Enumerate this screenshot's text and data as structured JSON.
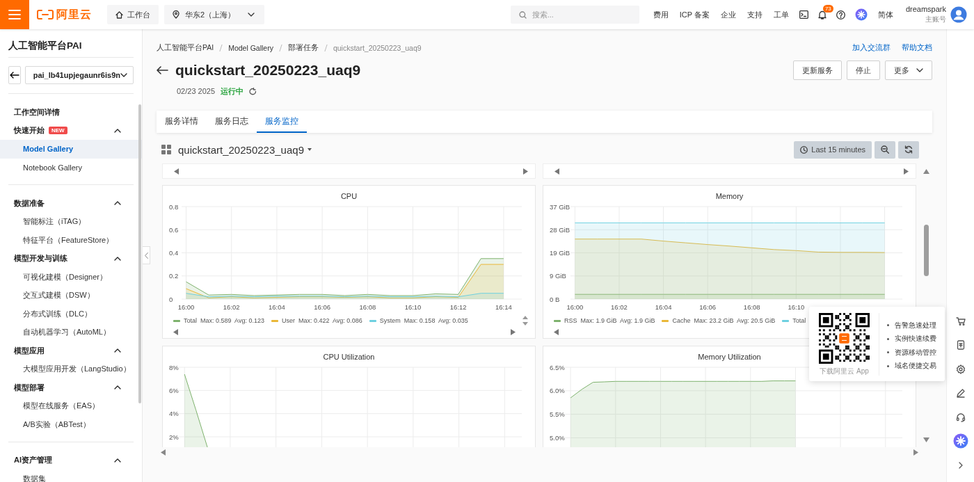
{
  "topbar": {
    "logo": "阿里云",
    "workbench": "工作台",
    "region": "华东2（上海）",
    "search": {
      "placeholder": "搜索..."
    },
    "links": [
      "费用",
      "ICP 备案",
      "企业",
      "支持",
      "工单"
    ],
    "notifications": "73",
    "language": "简体",
    "user": {
      "name": "dreamspark",
      "role": "主账号"
    }
  },
  "sidebar": {
    "title": "人工智能平台PAI",
    "workspace": "pai_lb41upjegaunr6is9n",
    "sections": [
      {
        "items": [
          {
            "kind": "link",
            "label": "工作空间详情"
          },
          {
            "kind": "group",
            "label": "快速开始",
            "badge": "NEW",
            "expanded": true,
            "children": [
              {
                "label": "Model Gallery",
                "selected": true
              },
              {
                "label": "Notebook Gallery",
                "selected": false
              }
            ]
          }
        ]
      },
      {
        "items": [
          {
            "kind": "group",
            "label": "数据准备",
            "expanded": true,
            "children": [
              {
                "label": "智能标注（iTAG）",
                "selected": false
              },
              {
                "label": "特征平台（FeatureStore）",
                "selected": false
              }
            ]
          },
          {
            "kind": "group",
            "label": "模型开发与训练",
            "expanded": true,
            "children": [
              {
                "label": "可视化建模（Designer）",
                "selected": false
              },
              {
                "label": "交互式建模（DSW）",
                "selected": false
              },
              {
                "label": "分布式训练（DLC）",
                "selected": false
              },
              {
                "label": "自动机器学习（AutoML）",
                "selected": false
              }
            ]
          },
          {
            "kind": "group",
            "label": "模型应用",
            "expanded": true,
            "children": [
              {
                "label": "大模型应用开发（LangStudio）",
                "selected": false
              }
            ]
          },
          {
            "kind": "group",
            "label": "模型部署",
            "expanded": true,
            "children": [
              {
                "label": "模型在线服务（EAS）",
                "selected": false
              },
              {
                "label": "A/B实验（ABTest）",
                "selected": false
              }
            ]
          }
        ]
      },
      {
        "items": [
          {
            "kind": "group",
            "label": "AI资产管理",
            "expanded": true,
            "children": [
              {
                "label": "数据集",
                "selected": false
              }
            ]
          }
        ]
      }
    ]
  },
  "header": {
    "breadcrumb": [
      "人工智能平台PAI",
      "Model Gallery",
      "部署任务",
      "quickstart_20250223_uaq9"
    ],
    "links": [
      "加入交流群",
      "帮助文档"
    ],
    "title": "quickstart_20250223_uaq9",
    "buttons": [
      {
        "label": "更新服务",
        "kind": "button"
      },
      {
        "label": "停止",
        "kind": "button"
      },
      {
        "label": "更多",
        "kind": "dropdown"
      }
    ],
    "date": "02/23 2025",
    "status": "运行中",
    "tabs": [
      {
        "label": "服务详情",
        "selected": false
      },
      {
        "label": "服务日志",
        "selected": false
      },
      {
        "label": "服务监控",
        "selected": true
      }
    ]
  },
  "dashboard": {
    "name": "quickstart_20250223_uaq9",
    "time_range": "Last 15 minutes",
    "panels": [
      {
        "legend_stats": [
          "Max: 0.589  Avg: 0.123",
          "Max: 0.422  Avg: 0.086",
          "Max: 0.158  Avg: 0.035"
        ],
        "chart_data": {
          "type": "area",
          "title": "CPU",
          "grid": true,
          "legend": "bottom",
          "categories": [
            "16:00",
            null,
            "16:02",
            null,
            "16:04",
            null,
            "16:06",
            null,
            "16:08",
            null,
            "16:10",
            null,
            "16:12",
            null,
            "16:14"
          ],
          "ylim": [
            0,
            0.8
          ],
          "yticks": [
            0,
            0.2,
            0.4,
            0.6,
            0.8
          ],
          "series": [
            {
              "name": "Total",
              "color": "#7eb26d",
              "values": [
                0.15,
                0.035,
                0.04,
                0.03,
                0.035,
                0.04,
                0.04,
                0.03,
                0.04,
                0.03,
                0.03,
                0.045,
                0.04,
                0.35,
                0.35
              ]
            },
            {
              "name": "User",
              "color": "#eab839",
              "values": [
                0.09,
                0.01,
                0.02,
                0.01,
                0.015,
                0.02,
                0.02,
                0.015,
                0.02,
                0.01,
                0.01,
                0.02,
                0.015,
                0.3,
                0.3
              ]
            },
            {
              "name": "System",
              "color": "#6ed0e0",
              "values": [
                0.05,
                0.02,
                0.025,
                0.02,
                0.025,
                0.025,
                0.025,
                0.02,
                0.025,
                0.02,
                0.02,
                0.025,
                0.02,
                0.05,
                0.05
              ]
            }
          ]
        }
      },
      {
        "legend_stats": [
          "Max: 1.9 GiB  Avg: 1.9 GiB",
          "Max: 23.2 GiB  Avg: 20.5 GiB"
        ],
        "chart_data": {
          "type": "area",
          "title": "Memory",
          "grid": true,
          "legend": "bottom",
          "categories": [
            "16:00",
            null,
            "16:02",
            null,
            "16:04",
            null,
            "16:06",
            null,
            "16:08",
            null,
            "16:10",
            null,
            null,
            null,
            null
          ],
          "ylim": [
            0,
            37
          ],
          "yticks": [
            {
              "value": 0,
              "label": "0 B"
            },
            {
              "value": 9.25,
              "label": "9 GiB"
            },
            {
              "value": 18.5,
              "label": "19 GiB"
            },
            {
              "value": 27.75,
              "label": "28 GiB"
            },
            {
              "value": 37,
              "label": "37 GiB"
            }
          ],
          "series": [
            {
              "name": "RSS",
              "color": "#7eb26d",
              "values": [
                1.9,
                1.9,
                1.9,
                1.9,
                1.9,
                1.9,
                1.9,
                1.9,
                1.9,
                1.9,
                1.9,
                1.9,
                1.9,
                1.9,
                1.9
              ]
            },
            {
              "name": "Cache",
              "color": "#eab839",
              "values": [
                24,
                24,
                24,
                24,
                23.2,
                22.5,
                21.8,
                21.2,
                20.5,
                19.8,
                19.4,
                18.8,
                18.7,
                18.7,
                18.6
              ]
            },
            {
              "name": "Total",
              "color": "#6ed0e0",
              "values": [
                30.5,
                30.5,
                30.5,
                30.5,
                30.5,
                30.5,
                30.5,
                30.5,
                30.5,
                30.5,
                30.5,
                30.5,
                30.5,
                30.5,
                30.5
              ]
            }
          ]
        }
      },
      {
        "chart_data": {
          "type": "area",
          "title": "CPU Utilization",
          "grid": true,
          "categories": [
            null,
            null,
            null,
            null,
            null,
            null,
            null,
            null,
            null,
            null,
            null,
            null,
            null,
            null,
            null,
            null,
            null,
            null,
            null,
            null,
            null,
            null,
            null,
            null,
            null,
            null,
            null,
            null,
            null,
            null
          ],
          "ylim": [
            1.1,
            8
          ],
          "yticks": [
            {
              "value": 2,
              "label": "2%"
            },
            {
              "value": 4,
              "label": "4%"
            },
            {
              "value": 6,
              "label": "6%"
            },
            {
              "value": 8,
              "label": "8%"
            }
          ],
          "series": [
            {
              "color": "#7eb26d",
              "values": [
                7.4,
                4.3,
                1.1,
                null,
                null,
                null,
                null,
                null,
                null,
                null,
                null,
                null,
                null,
                null,
                null,
                null,
                null,
                null,
                null,
                null,
                null,
                null,
                null,
                null,
                null,
                null,
                null,
                null,
                null,
                null
              ]
            }
          ]
        }
      },
      {
        "chart_data": {
          "type": "area",
          "title": "Memory Utilization",
          "grid": true,
          "categories": [
            null,
            null,
            null,
            null,
            null,
            null,
            null,
            null,
            null,
            null,
            null,
            null,
            null,
            null,
            null,
            null,
            null,
            null,
            null,
            null,
            null,
            null,
            null,
            null,
            null,
            null,
            null,
            null,
            null,
            null
          ],
          "ylim": [
            4.8,
            6.5
          ],
          "yticks": [
            {
              "value": 5,
              "label": "5.0%"
            },
            {
              "value": 5.5,
              "label": "5.5%"
            },
            {
              "value": 6,
              "label": "6.0%"
            },
            {
              "value": 6.5,
              "label": "6.5%"
            }
          ],
          "series": [
            {
              "color": "#7eb26d",
              "values": [
                5.85,
                6.03,
                6.18,
                6.19,
                6.2,
                6.2,
                6.2,
                6.2,
                6.2,
                6.2,
                6.2,
                6.2,
                6.2,
                6.2,
                6.2,
                6.2,
                6.2,
                6.2,
                6.21,
                6.21,
                6.21,
                null,
                null,
                null,
                null,
                null,
                null,
                null,
                null,
                null
              ]
            }
          ]
        }
      }
    ]
  },
  "app_promo": {
    "caption": "下载阿里云 App",
    "features": [
      "告警急速处理",
      "实例快速续费",
      "资源移动管控",
      "域名便捷交易"
    ]
  }
}
